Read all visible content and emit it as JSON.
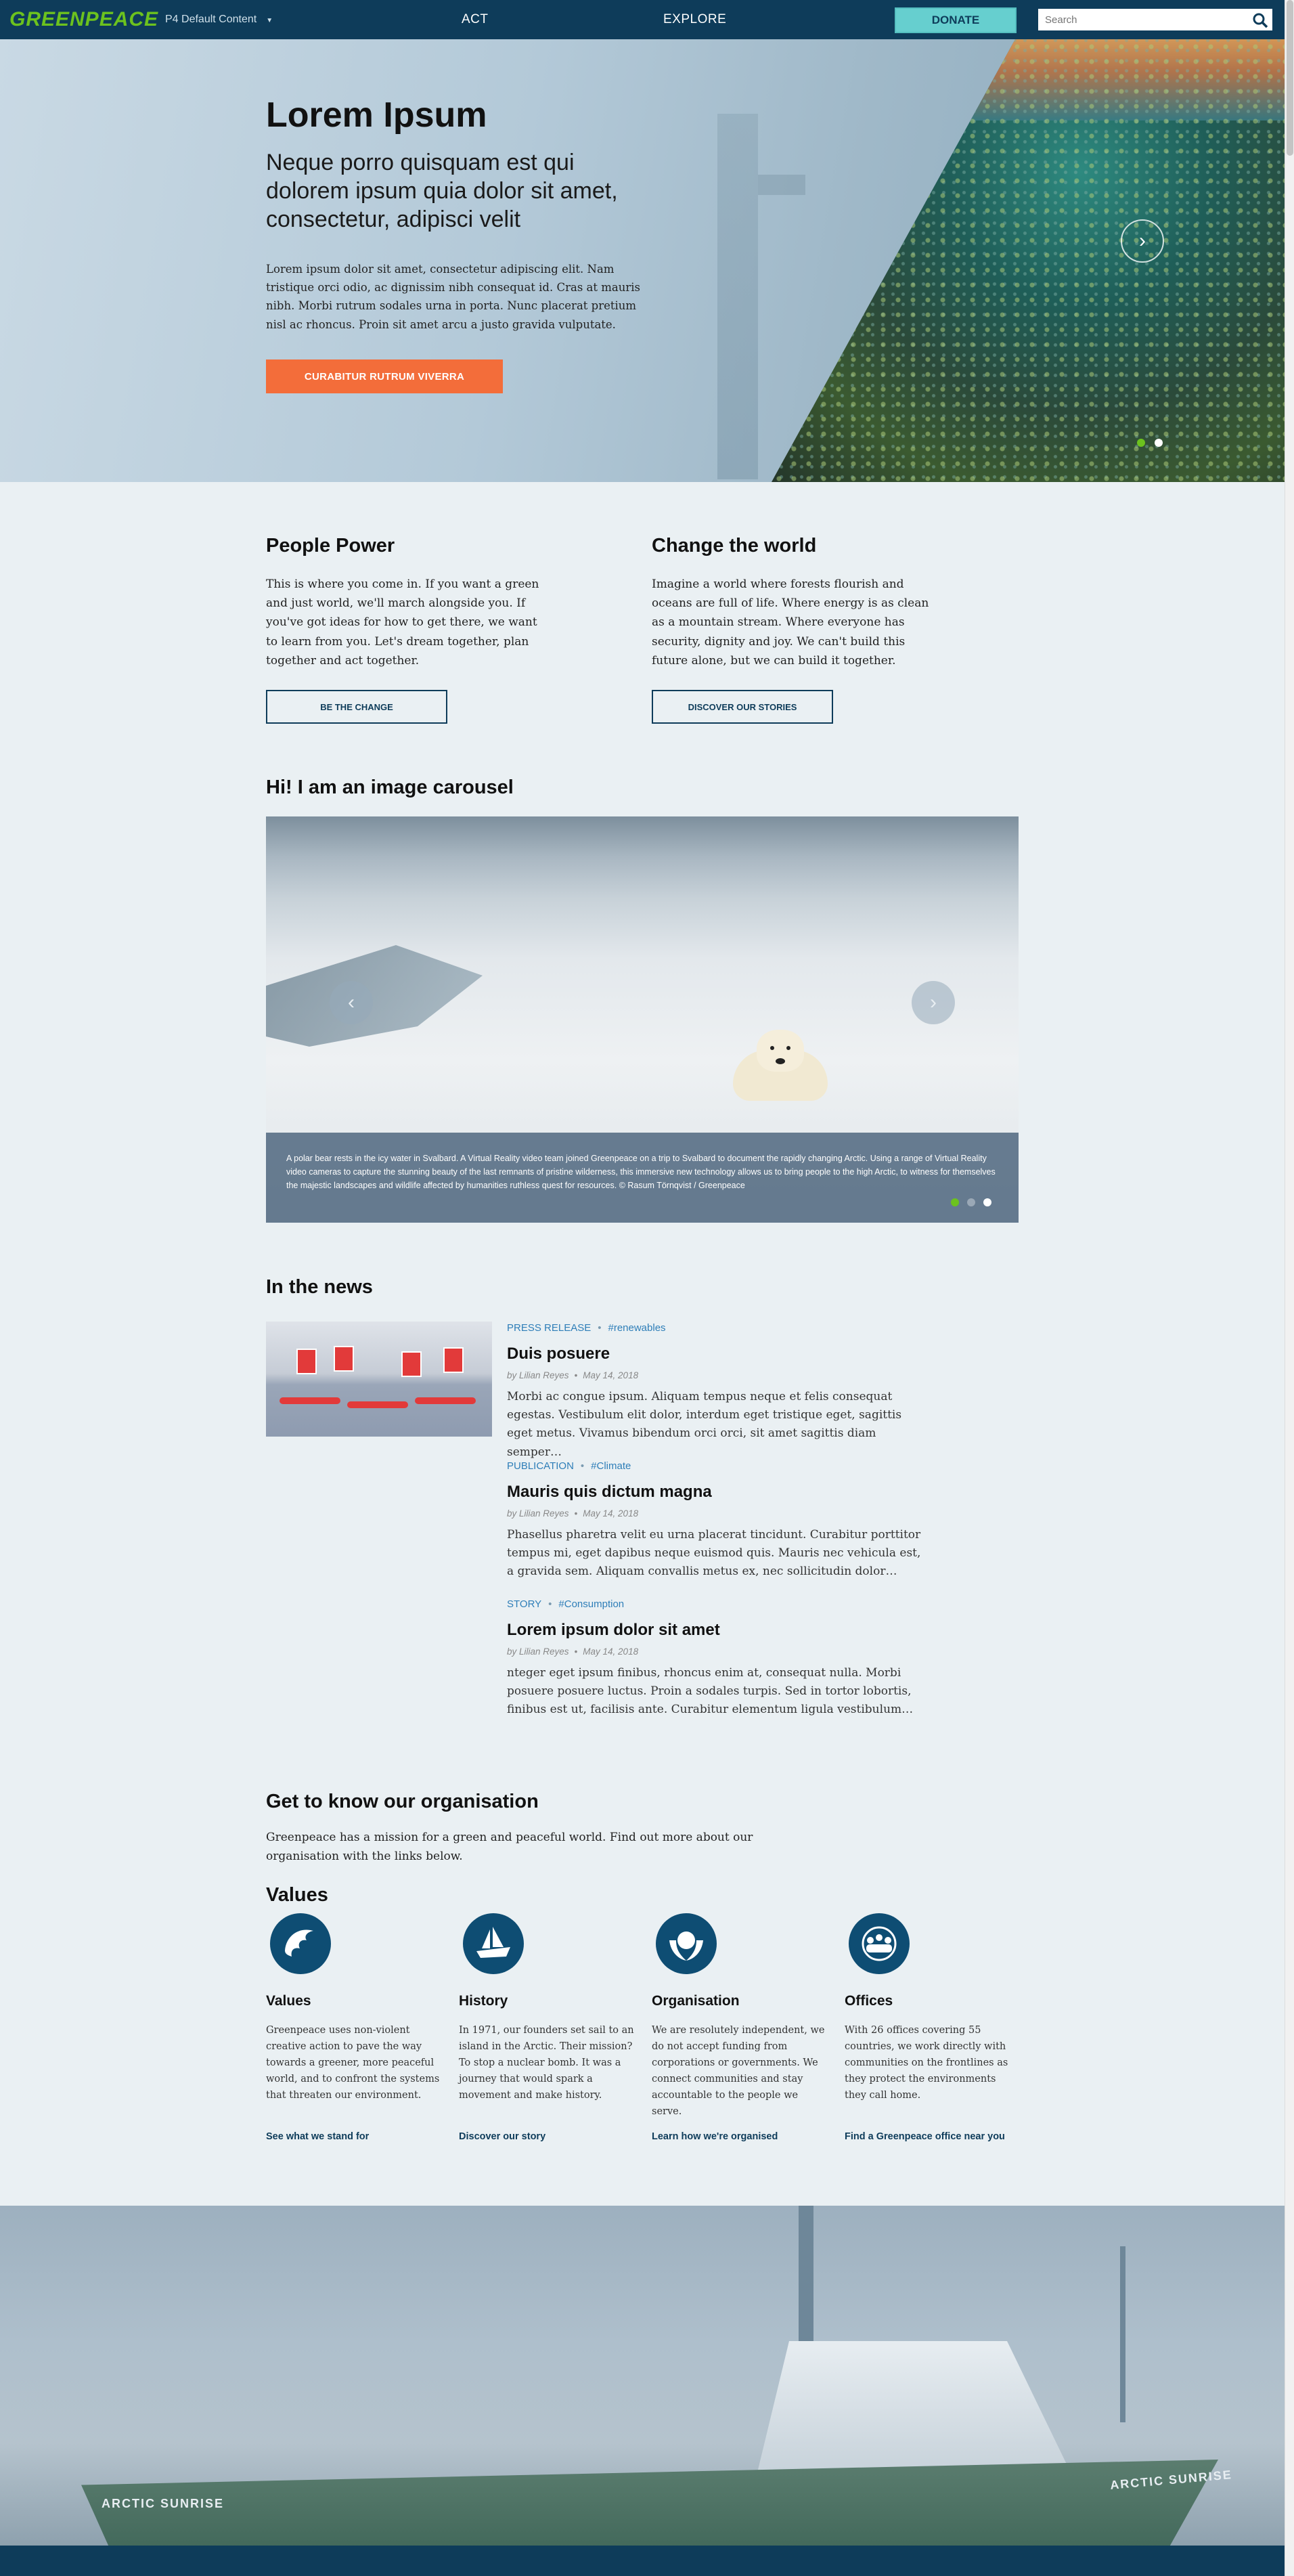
{
  "nav": {
    "logo": "GREENPEACE",
    "dropdown": "P4 Default Content",
    "links": [
      "ACT",
      "EXPLORE"
    ],
    "donate": "DONATE",
    "search_placeholder": "Search"
  },
  "hero": {
    "title": "Lorem Ipsum",
    "subtitle": "Neque porro quisquam est qui dolorem ipsum quia dolor sit amet, consectetur, adipisci velit",
    "body": "Lorem ipsum dolor sit amet, consectetur adipiscing elit. Nam tristique orci odio, ac dignissim nibh consequat id. Cras at mauris nibh. Morbi rutrum sodales urna in porta. Nunc placerat pretium nisl ac rhoncus. Proin sit amet arcu a justo gravida vulputate.",
    "cta": "CURABITUR RUTRUM VIVERRA",
    "slides": 2,
    "active_slide": 1
  },
  "columns": [
    {
      "title": "People Power",
      "body": "This is where you come in. If you want a green and just world, we'll march alongside you. If you've got ideas for how to get there, we want to learn from you. Let's dream together, plan together and act together.",
      "button": "BE THE CHANGE"
    },
    {
      "title": "Change the world",
      "body": "Imagine a world where forests flourish and oceans are full of life. Where energy is as clean as a mountain stream. Where everyone has security, dignity and joy. We can't build this future alone, but we can build it together.",
      "button": "DISCOVER OUR STORIES"
    }
  ],
  "carousel": {
    "title": "Hi! I am an image carousel",
    "caption": "A polar bear rests in the icy water in Svalbard. A Virtual Reality video team joined Greenpeace on a trip to Svalbard to document the rapidly changing Arctic. Using a range of Virtual Reality video cameras to capture the stunning beauty of the last remnants of pristine wilderness, this immersive new technology allows us to bring people to the high Arctic, to witness for themselves the majestic landscapes and wildlife affected by humanities ruthless quest for resources. © Rasum Törnqvist / Greenpeace",
    "slides": 3,
    "active_slide": 1
  },
  "news": {
    "title": "In the news",
    "items": [
      {
        "type": "PRESS RELEASE",
        "tag": "#renewables",
        "title": "Duis posuere",
        "author": "by Lilian Reyes",
        "date": "May 14, 2018",
        "excerpt": "Morbi ac congue ipsum. Aliquam tempus neque et felis consequat egestas. Vestibulum elit dolor, interdum eget tristique eget, sagittis eget metus. Vivamus bibendum orci orci, sit amet sagittis diam semper…"
      },
      {
        "type": "PUBLICATION",
        "tag": "#Climate",
        "title": "Mauris quis dictum magna",
        "author": "by Lilian Reyes",
        "date": "May 14, 2018",
        "excerpt": "Phasellus pharetra velit eu urna placerat tincidunt. Curabitur porttitor tempus mi, eget dapibus neque euismod quis. Mauris nec vehicula est, a gravida sem. Aliquam convallis metus ex, nec sollicitudin dolor…"
      },
      {
        "type": "STORY",
        "tag": "#Consumption",
        "title": "Lorem ipsum dolor sit amet",
        "author": "by Lilian Reyes",
        "date": "May 14, 2018",
        "excerpt": "nteger eget ipsum finibus, rhoncus enim at, consequat nulla. Morbi posuere posuere luctus. Proin a sodales turpis. Sed in tortor lobortis, finibus est ut, facilisis ante. Curabitur elementum ligula vestibulum…"
      }
    ]
  },
  "org": {
    "title": "Get to know our organisation",
    "intro": "Greenpeace has a mission for a green and peaceful world. Find out more about our organisation with the links below.",
    "values_title": "Values",
    "items": [
      {
        "icon": "eagle-icon",
        "title": "Values",
        "body": "Greenpeace uses non-violent creative action to pave the way towards a greener, more peaceful world, and to confront the systems that threaten our environment.",
        "link": "See what we stand for"
      },
      {
        "icon": "ship-icon",
        "title": "History",
        "body": "In 1971, our founders set sail to an island in the Arctic. Their mission? To stop a nuclear bomb. It was a journey that would spark a movement and make history.",
        "link": "Discover our story"
      },
      {
        "icon": "hands-globe-icon",
        "title": "Organisation",
        "body": "We are resolutely independent, we do not accept funding from corporations or governments. We connect communities and stay accountable to the people we serve.",
        "link": "Learn how we're organised"
      },
      {
        "icon": "people-globe-icon",
        "title": "Offices",
        "body": "With 26 offices covering 55 countries, we work directly with communities on the frontlines as they protect the environments they call home.",
        "link": "Find a Greenpeace office near you"
      }
    ]
  },
  "footer": {
    "ship_name": "ARCTIC SUNRISE"
  },
  "colors": {
    "nav": "#0e3c5a",
    "accent_green": "#6cc21e",
    "donate": "#66cfcf",
    "cta_orange": "#f36d3a",
    "link_blue": "#2e7eb8",
    "page_bg": "#eaf0f3"
  }
}
